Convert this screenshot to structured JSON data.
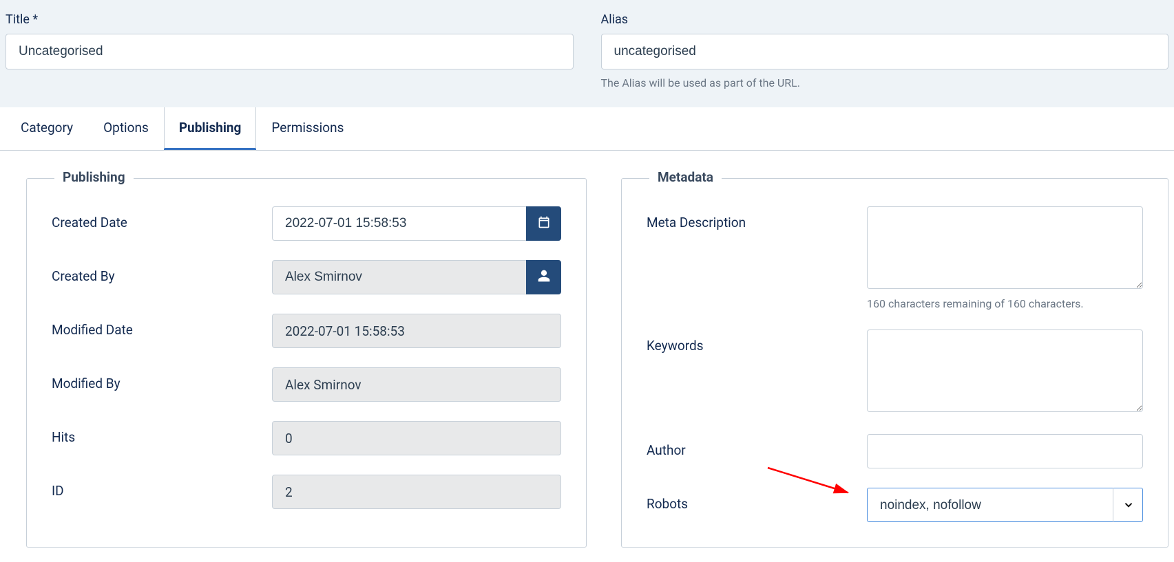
{
  "top": {
    "title_label": "Title *",
    "title_value": "Uncategorised",
    "alias_label": "Alias",
    "alias_value": "uncategorised",
    "alias_help": "The Alias will be used as part of the URL."
  },
  "tabs": {
    "category": "Category",
    "options": "Options",
    "publishing": "Publishing",
    "permissions": "Permissions"
  },
  "publishing": {
    "legend": "Publishing",
    "created_date_label": "Created Date",
    "created_date_value": "2022-07-01 15:58:53",
    "created_by_label": "Created By",
    "created_by_value": "Alex Smirnov",
    "modified_date_label": "Modified Date",
    "modified_date_value": "2022-07-01 15:58:53",
    "modified_by_label": "Modified By",
    "modified_by_value": "Alex Smirnov",
    "hits_label": "Hits",
    "hits_value": "0",
    "id_label": "ID",
    "id_value": "2"
  },
  "metadata": {
    "legend": "Metadata",
    "meta_desc_label": "Meta Description",
    "meta_desc_value": "",
    "meta_desc_counter": "160 characters remaining of 160 characters.",
    "keywords_label": "Keywords",
    "keywords_value": "",
    "author_label": "Author",
    "author_value": "",
    "robots_label": "Robots",
    "robots_value": "noindex, nofollow"
  }
}
